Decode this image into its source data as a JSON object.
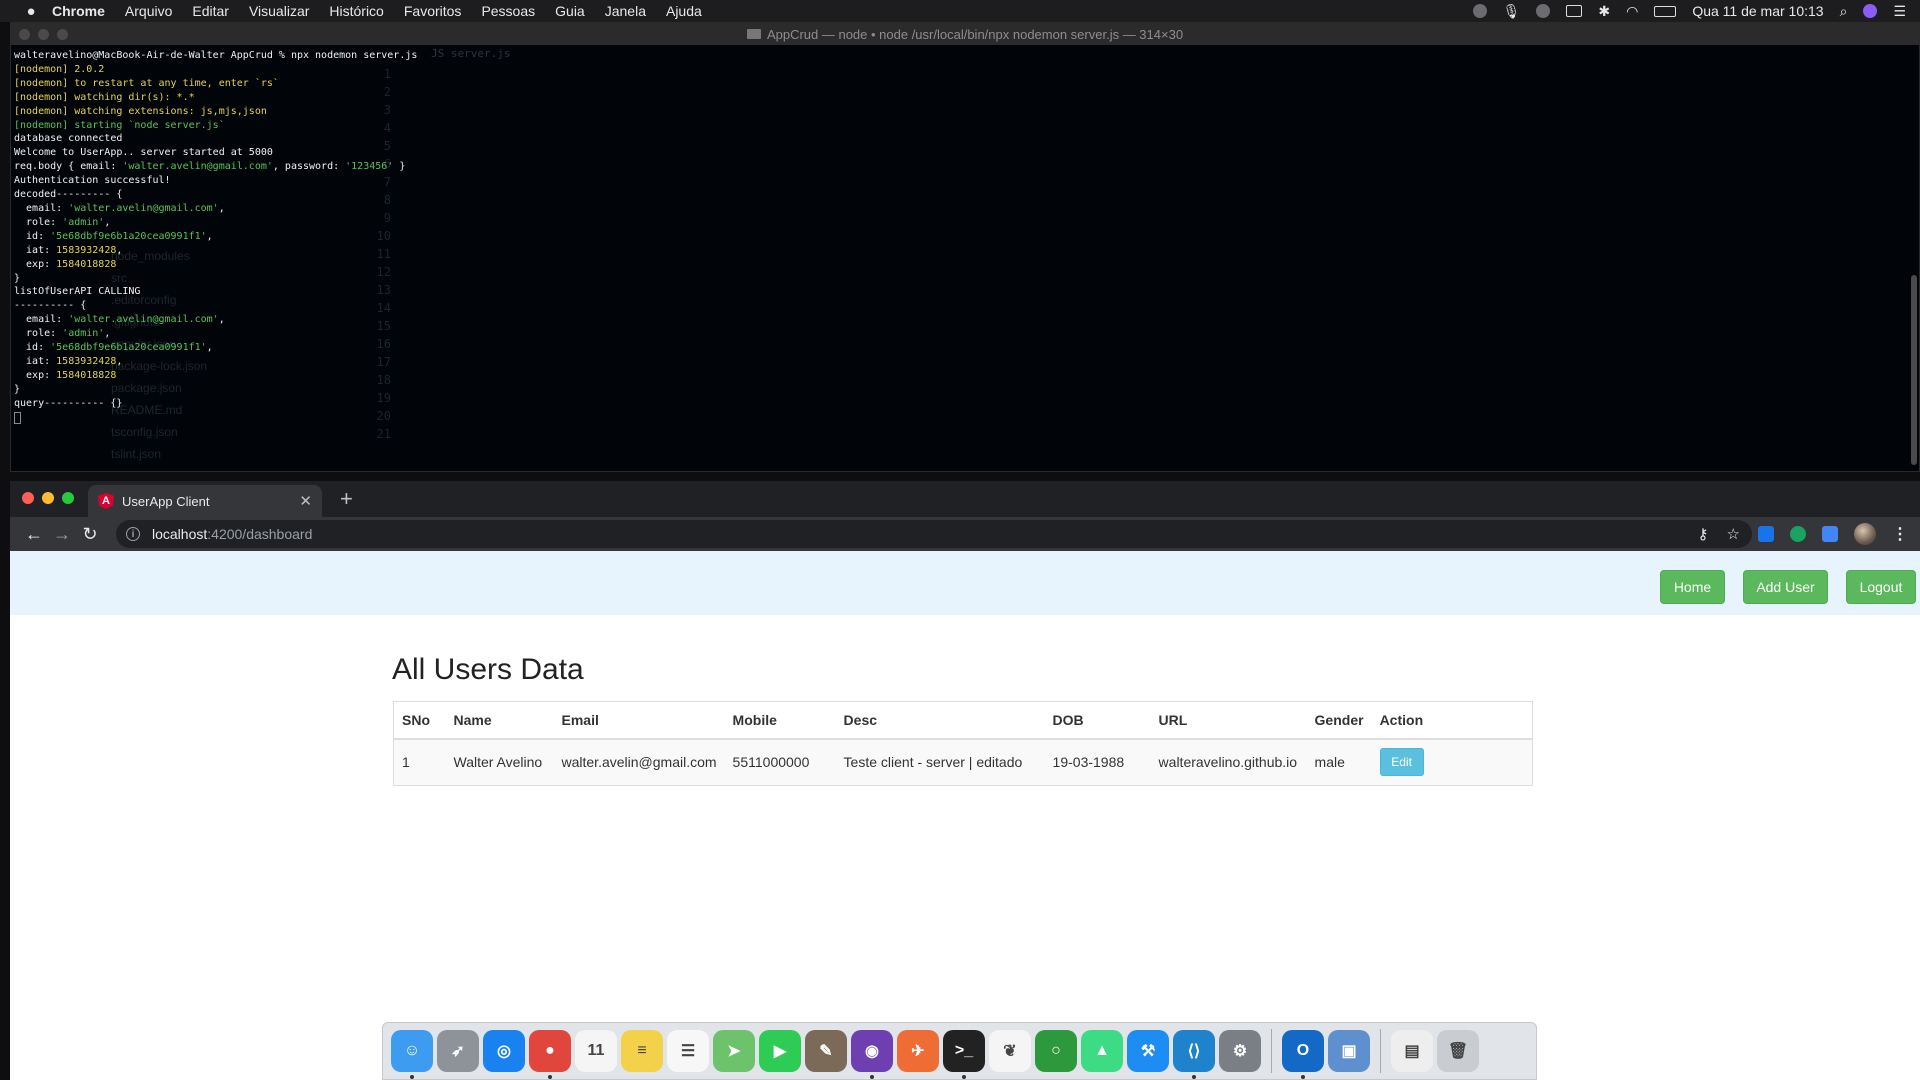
{
  "menubar": {
    "app_name": "Chrome",
    "items": [
      "Arquivo",
      "Editar",
      "Visualizar",
      "Histórico",
      "Favoritos",
      "Pessoas",
      "Guia",
      "Janela",
      "Ajuda"
    ],
    "datetime": "Qua 11 de mar  10:13"
  },
  "terminal": {
    "title": "AppCrud — node • node /usr/local/bin/npx nodemon server.js — 314×30",
    "lines": [
      [
        [
          "w",
          "walteravelino@MacBook-Air-de-Walter AppCrud % npx nodemon server.js"
        ]
      ],
      [
        [
          "y",
          "[nodemon] 2.0.2"
        ]
      ],
      [
        [
          "y",
          "[nodemon] to restart at any time, enter `rs`"
        ]
      ],
      [
        [
          "y",
          "[nodemon] watching dir(s): *.*"
        ]
      ],
      [
        [
          "y",
          "[nodemon] watching extensions: js,mjs,json"
        ]
      ],
      [
        [
          "g",
          "[nodemon] starting `node server.js`"
        ]
      ],
      [
        [
          "w",
          "database connected"
        ]
      ],
      [
        [
          "w",
          "Welcome to UserApp.. server started at 5000"
        ]
      ],
      [
        [
          "w",
          "req.body { email: "
        ],
        [
          "g",
          "'walter.avelin@gmail.com'"
        ],
        [
          "w",
          ", password: "
        ],
        [
          "g",
          "'123456'"
        ],
        [
          "w",
          " }"
        ]
      ],
      [
        [
          "w",
          "Authentication successful!"
        ]
      ],
      [
        [
          "w",
          "decoded--------- {"
        ]
      ],
      [
        [
          "w",
          "  email: "
        ],
        [
          "g",
          "'walter.avelin@gmail.com'"
        ],
        [
          "w",
          ","
        ]
      ],
      [
        [
          "w",
          "  role: "
        ],
        [
          "g",
          "'admin'"
        ],
        [
          "w",
          ","
        ]
      ],
      [
        [
          "w",
          "  id: "
        ],
        [
          "g",
          "'5e68dbf9e6b1a20cea0991f1'"
        ],
        [
          "w",
          ","
        ]
      ],
      [
        [
          "w",
          "  iat: "
        ],
        [
          "y",
          "1583932428"
        ],
        [
          "w",
          ","
        ]
      ],
      [
        [
          "w",
          "  exp: "
        ],
        [
          "y",
          "1584018828"
        ]
      ],
      [
        [
          "w",
          "}"
        ]
      ],
      [
        [
          "w",
          "listOfUserAPI CALLING"
        ]
      ],
      [
        [
          "w",
          "---------- {"
        ]
      ],
      [
        [
          "w",
          "  email: "
        ],
        [
          "g",
          "'walter.avelin@gmail.com'"
        ],
        [
          "w",
          ","
        ]
      ],
      [
        [
          "w",
          "  role: "
        ],
        [
          "g",
          "'admin'"
        ],
        [
          "w",
          ","
        ]
      ],
      [
        [
          "w",
          "  id: "
        ],
        [
          "g",
          "'5e68dbf9e6b1a20cea0991f1'"
        ],
        [
          "w",
          ","
        ]
      ],
      [
        [
          "w",
          "  iat: "
        ],
        [
          "y",
          "1583932428"
        ],
        [
          "w",
          ","
        ]
      ],
      [
        [
          "w",
          "  exp: "
        ],
        [
          "y",
          "1584018828"
        ]
      ],
      [
        [
          "w",
          "}"
        ]
      ],
      [
        [
          "w",
          "query---------- {}"
        ]
      ]
    ]
  },
  "browser": {
    "tab_title": "UserApp Client",
    "url_host": "localhost",
    "url_path": ":4200/dashboard"
  },
  "app": {
    "nav": {
      "home": "Home",
      "add_user": "Add User",
      "logout": "Logout"
    },
    "heading": "All Users Data",
    "table": {
      "headers": [
        "SNo",
        "Name",
        "Email",
        "Mobile",
        "Desc",
        "DOB",
        "URL",
        "Gender",
        "Action"
      ],
      "rows": [
        [
          "1",
          "Walter Avelino",
          "walter.avelin@gmail.com",
          "5511000000",
          "Teste client - server | editado",
          "19-03-1988",
          "walteravelino.github.io",
          "male"
        ]
      ],
      "edit_label": "Edit"
    }
  },
  "dock": {
    "apps": [
      {
        "icon": "finder-icon",
        "color": "#3d9bf0",
        "glyph": "☺",
        "running": true
      },
      {
        "icon": "launchpad-icon",
        "color": "#8e9399",
        "glyph": "➶",
        "running": false
      },
      {
        "icon": "safari-icon",
        "color": "#1a82f0",
        "glyph": "◎",
        "running": false
      },
      {
        "icon": "chrome-icon",
        "color": "#e0463b",
        "glyph": "●",
        "running": true
      },
      {
        "icon": "calendar-icon",
        "color": "#f5f5f5",
        "glyph": "11",
        "running": false
      },
      {
        "icon": "notes-icon",
        "color": "#f3d24a",
        "glyph": "≡",
        "running": false
      },
      {
        "icon": "reminders-icon",
        "color": "#f7f7f7",
        "glyph": "☰",
        "running": false
      },
      {
        "icon": "maps-icon",
        "color": "#6cc36b",
        "glyph": "➤",
        "running": false
      },
      {
        "icon": "facetime-icon",
        "color": "#2ecc55",
        "glyph": "▶",
        "running": false
      },
      {
        "icon": "gimp-icon",
        "color": "#7a6a57",
        "glyph": "✎",
        "running": false
      },
      {
        "icon": "github-desktop-icon",
        "color": "#6d3fb0",
        "glyph": "◉",
        "running": true
      },
      {
        "icon": "postman-icon",
        "color": "#ef6c35",
        "glyph": "✈",
        "running": false
      },
      {
        "icon": "terminal-icon",
        "color": "#222222",
        "glyph": ">_",
        "running": true
      },
      {
        "icon": "mongodb-compass-icon",
        "color": "#f5f5f5",
        "glyph": "❦",
        "running": false
      },
      {
        "icon": "robo3t-icon",
        "color": "#2c9a3c",
        "glyph": "○",
        "running": false
      },
      {
        "icon": "android-studio-icon",
        "color": "#3ddc84",
        "glyph": "▲",
        "running": false
      },
      {
        "icon": "xcode-icon",
        "color": "#1d8cf3",
        "glyph": "⚒",
        "running": false
      },
      {
        "icon": "vscode-icon",
        "color": "#1f82cc",
        "glyph": "⟨⟩",
        "running": true
      },
      {
        "icon": "system-preferences-icon",
        "color": "#7a7f85",
        "glyph": "⚙",
        "running": false
      },
      {
        "sep": true
      },
      {
        "icon": "outlook-icon",
        "color": "#1469c7",
        "glyph": "O",
        "running": true
      },
      {
        "icon": "preview-icon",
        "color": "#5e8fcf",
        "glyph": "▣",
        "running": false
      },
      {
        "sep": true
      },
      {
        "icon": "downloads-folder-icon",
        "color": "#eeeeee",
        "glyph": "▤",
        "running": false
      },
      {
        "icon": "trash-icon",
        "color": "#c9cdd1",
        "glyph": "🗑",
        "running": false
      }
    ]
  }
}
